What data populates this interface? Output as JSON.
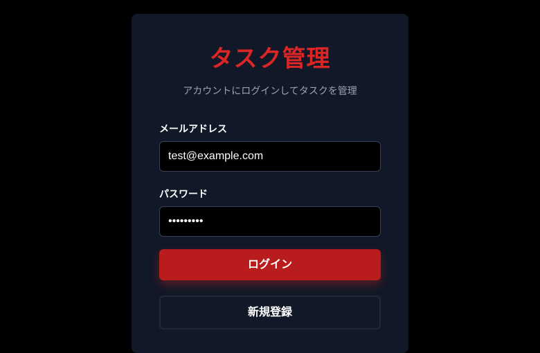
{
  "login": {
    "title": "タスク管理",
    "subtitle": "アカウントにログインしてタスクを管理",
    "email_label": "メールアドレス",
    "email_value": "test@example.com",
    "password_label": "パスワード",
    "password_value": "•••••••••",
    "login_button": "ログイン",
    "register_button": "新規登録"
  },
  "colors": {
    "background": "#000000",
    "card": "#111827",
    "accent": "#dc2626",
    "button": "#b91c1c"
  }
}
